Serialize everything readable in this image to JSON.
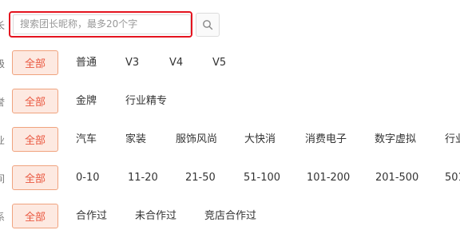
{
  "search": {
    "label_fragment": "长",
    "placeholder": "搜索团长昵称，最多20个字",
    "button_icon": "search-icon"
  },
  "filters": [
    {
      "label_fragment": "级",
      "all_label": "全部",
      "options": [
        "普通",
        "V3",
        "V4",
        "V5"
      ]
    },
    {
      "label_fragment": "誉",
      "all_label": "全部",
      "options": [
        "金牌",
        "行业精专"
      ]
    },
    {
      "label_fragment": "业",
      "all_label": "全部",
      "options": [
        "汽车",
        "家装",
        "服饰风尚",
        "大快消",
        "消费电子",
        "数字虚拟",
        "行业"
      ]
    },
    {
      "label_fragment": "间",
      "all_label": "全部",
      "options": [
        "0-10",
        "11-20",
        "21-50",
        "51-100",
        "101-200",
        "201-500",
        "501"
      ]
    },
    {
      "label_fragment": "系",
      "all_label": "全部",
      "options": [
        "合作过",
        "未合作过",
        "竞店合作过"
      ]
    }
  ],
  "colors": {
    "accent": "#e9573f",
    "chip_bg": "#fde9e1",
    "highlight_border": "#e4141f"
  }
}
